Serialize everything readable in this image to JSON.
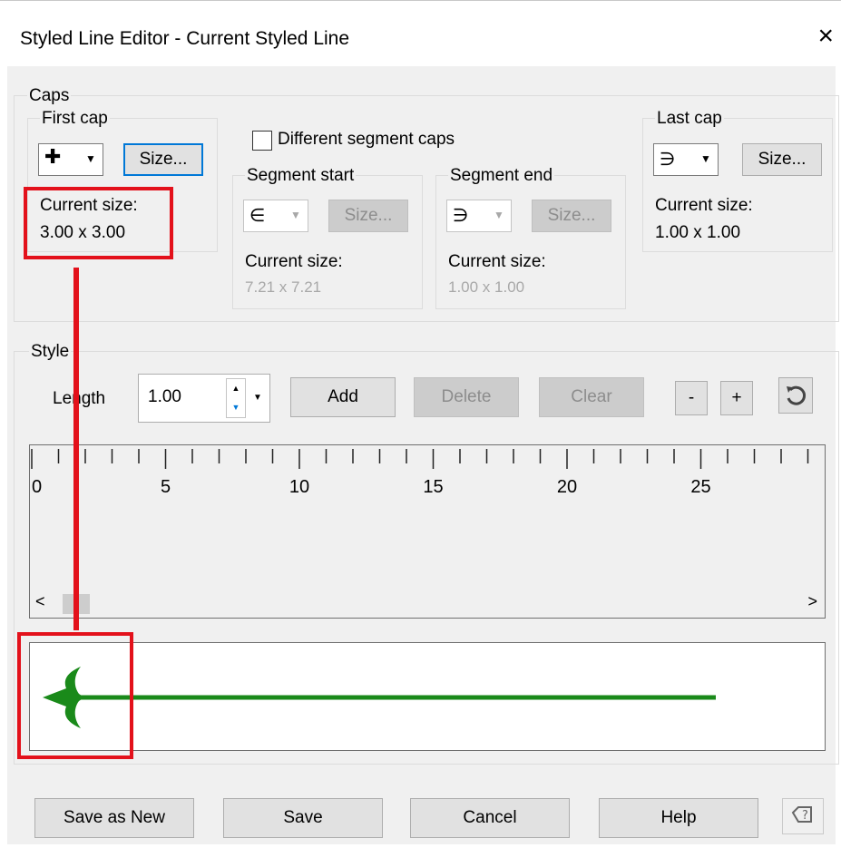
{
  "window": {
    "title": "Styled Line Editor -  Current Styled Line",
    "close_glyph": "×"
  },
  "caps": {
    "group_label": "Caps",
    "first_cap": {
      "label": "First cap",
      "glyph": "✚",
      "size_button": "Size...",
      "current_size_label": "Current size:",
      "current_size_value": "3.00 x 3.00"
    },
    "different_segment_caps": {
      "label": "Different segment caps",
      "checked": false
    },
    "segment_start": {
      "label": "Segment start",
      "glyph": "∈",
      "size_button": "Size...",
      "current_size_label": "Current size:",
      "current_size_value": "7.21 x 7.21"
    },
    "segment_end": {
      "label": "Segment end",
      "glyph": "∋",
      "size_button": "Size...",
      "current_size_label": "Current size:",
      "current_size_value": "1.00 x 1.00"
    },
    "last_cap": {
      "label": "Last cap",
      "glyph": "∋",
      "size_button": "Size...",
      "current_size_label": "Current size:",
      "current_size_value": "1.00 x 1.00"
    }
  },
  "style": {
    "group_label": "Style",
    "length_label": "Length",
    "length_value": "1.00",
    "add_button": "Add",
    "delete_button": "Delete",
    "clear_button": "Clear",
    "zoom_out_button": "-",
    "zoom_in_button": "+",
    "reset_icon": "undo-icon",
    "ruler_labels": [
      "0",
      "5",
      "10",
      "15",
      "20",
      "25"
    ],
    "scroll_left": "<",
    "scroll_right": ">"
  },
  "preview": {
    "line_color": "#1a8a1a"
  },
  "footer": {
    "save_as_new": "Save as New",
    "save": "Save",
    "cancel": "Cancel",
    "help": "Help",
    "help_icon": "context-help-icon"
  },
  "colors": {
    "highlight": "#e3111b",
    "focus": "#0078d7"
  }
}
